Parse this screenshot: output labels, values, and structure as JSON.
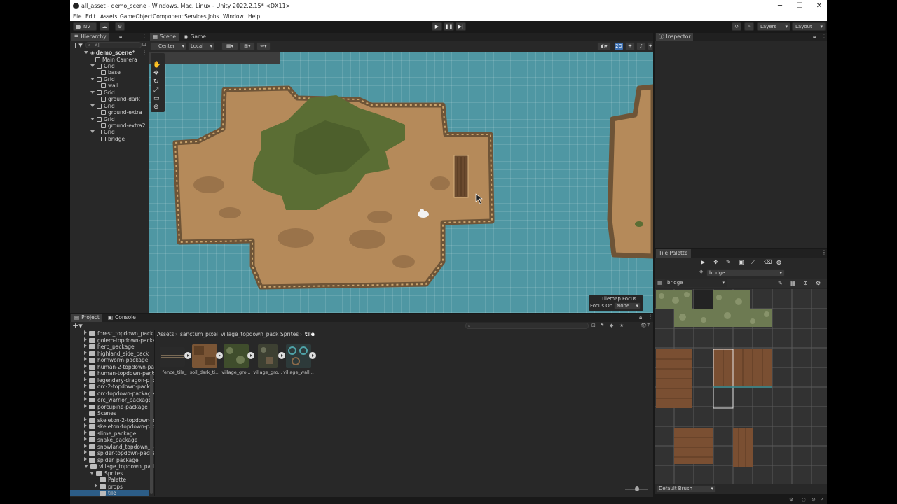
{
  "window": {
    "title": "all_asset - demo_scene - Windows, Mac, Linux - Unity 2022.2.15* <DX11>",
    "minimize": "─",
    "maximize": "☐",
    "close": "✕"
  },
  "menu": [
    "File",
    "Edit",
    "Assets",
    "GameObject",
    "Component",
    "Services",
    "Jobs",
    "Window",
    "Help"
  ],
  "toolbar": {
    "account": "NV",
    "layers": "Layers",
    "layout": "Layout"
  },
  "hierarchy": {
    "tab": "Hierarchy",
    "search_placeholder": "All",
    "scene": "demo_scene*",
    "items": [
      {
        "label": "Main Camera"
      },
      {
        "label": "Grid"
      },
      {
        "label": "base"
      },
      {
        "label": "Grid"
      },
      {
        "label": "wall"
      },
      {
        "label": "Grid"
      },
      {
        "label": "ground-dark"
      },
      {
        "label": "Grid"
      },
      {
        "label": "ground-extra"
      },
      {
        "label": "Grid"
      },
      {
        "label": "ground-extra2"
      },
      {
        "label": "Grid"
      },
      {
        "label": "bridge"
      }
    ]
  },
  "scene": {
    "tab_scene": "Scene",
    "tab_game": "Game",
    "pivot": "Center",
    "space": "Local",
    "mode_2d": "2D",
    "tilemap_focus_title": "Tilemap Focus",
    "focus_on_label": "Focus On",
    "focus_on_value": "None"
  },
  "inspector": {
    "tab": "Inspector"
  },
  "project": {
    "tab_project": "Project",
    "tab_console": "Console",
    "hidden_count": "7",
    "folders": [
      "forest_topdown_pack",
      "golem-topdown-package",
      "herb_package",
      "highland_side_pack",
      "hornworm-package",
      "human-2-topdown-pa",
      "human-topdown-pack",
      "legendary-dragon-pac",
      "orc-2-topdown-packa",
      "orc-topdown-package",
      "orc_warrior_package",
      "porcupine-package",
      "Scenes",
      "skeleton-2-topdown-p",
      "skeleton-topdown-pac",
      "slime_package",
      "snake_package",
      "snowland_topdown_pa",
      "spider-topdown-packa",
      "spider_package",
      "village_topdown_pack"
    ],
    "subfolders": [
      "Sprites",
      "Palette",
      "props",
      "tile"
    ],
    "breadcrumb": [
      "Assets",
      "sanctum_pixel",
      "village_topdown_pack",
      "Sprites",
      "tile"
    ],
    "assets": [
      "fence_tile_",
      "soil_dark_ti...",
      "village_gro...",
      "village_gro...",
      "village_wall..."
    ]
  },
  "tile_palette": {
    "tab": "Tile Palette",
    "active_tilemap": "bridge",
    "palette": "bridge",
    "brush": "Default Brush"
  },
  "colors": {
    "water": "#4f97a3",
    "sand": "#b58a5a",
    "grass": "#5b6e34",
    "panel": "#282828",
    "accent": "#3d6fb0"
  }
}
